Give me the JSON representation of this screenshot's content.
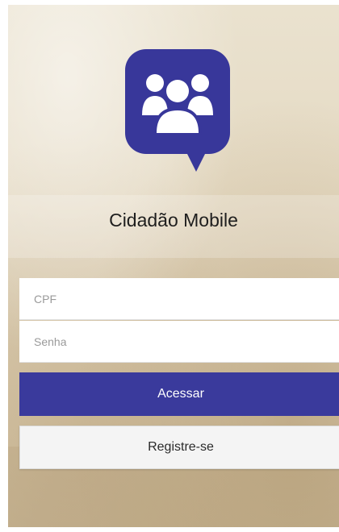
{
  "app": {
    "title": "Cidadão Mobile",
    "logo_icon": "group-users-icon",
    "brand_color": "#38379a"
  },
  "form": {
    "cpf_placeholder": "CPF",
    "senha_placeholder": "Senha",
    "login_label": "Acessar",
    "register_label": "Registre-se"
  }
}
